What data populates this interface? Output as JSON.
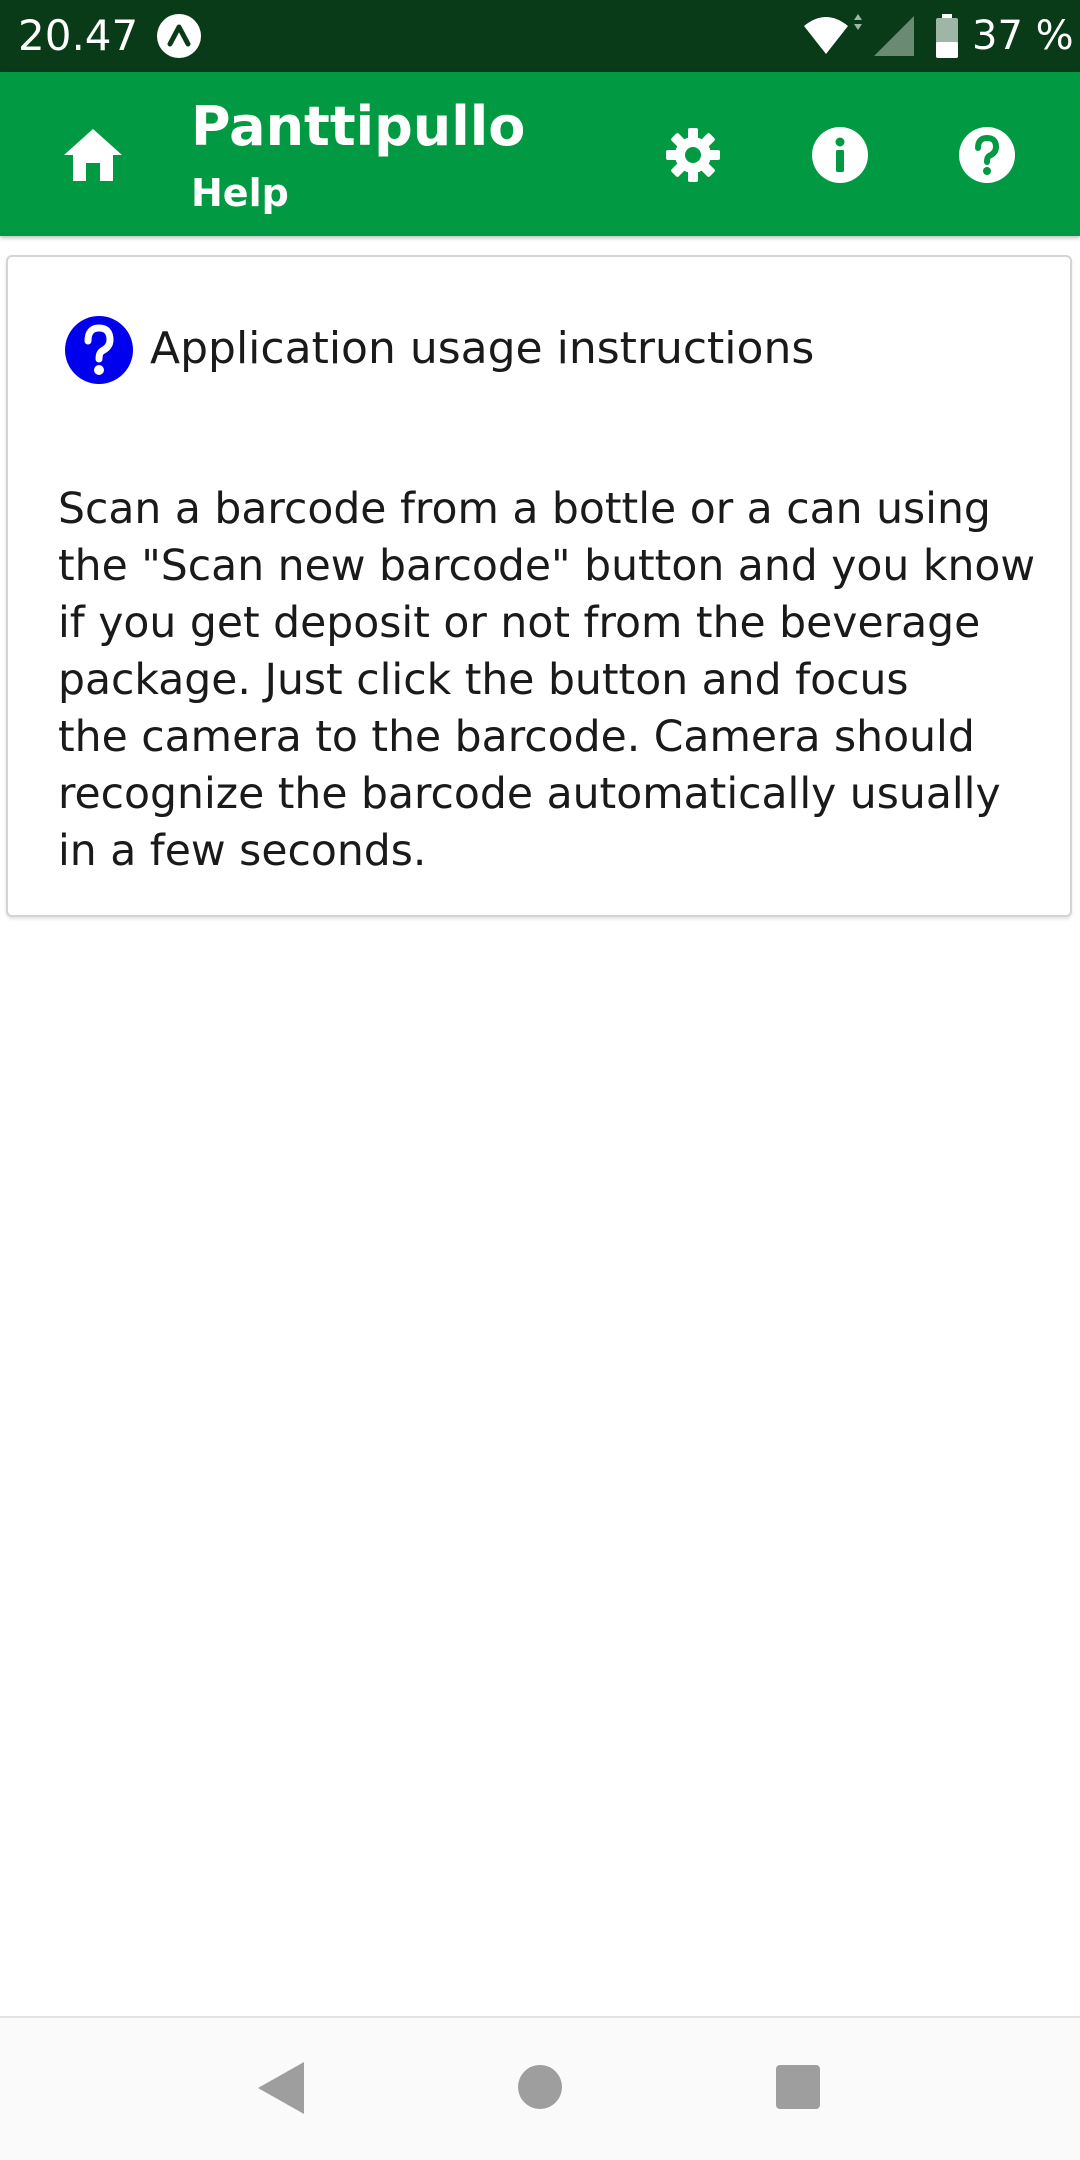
{
  "status_bar": {
    "time": "20.47",
    "battery_text": "37 %"
  },
  "app_bar": {
    "title": "Panttipullo",
    "subtitle": "Help",
    "icons": [
      "home-icon",
      "settings-icon",
      "info-icon",
      "help-icon"
    ],
    "color": "#019a43"
  },
  "card": {
    "title": "Application usage instructions",
    "icon": "help-icon",
    "icon_color": "#0000ee",
    "body": "Scan a barcode from a bottle or a can using\nthe \"Scan new barcode\" button and you know\nif you get deposit or not from the beverage\npackage. Just click the button and focus\nthe camera to the barcode. Camera should\nrecognize the barcode automatically usually\nin a few seconds."
  },
  "nav_bar": {
    "icons": [
      "back-icon",
      "home-circle-icon",
      "recent-apps-icon"
    ]
  }
}
